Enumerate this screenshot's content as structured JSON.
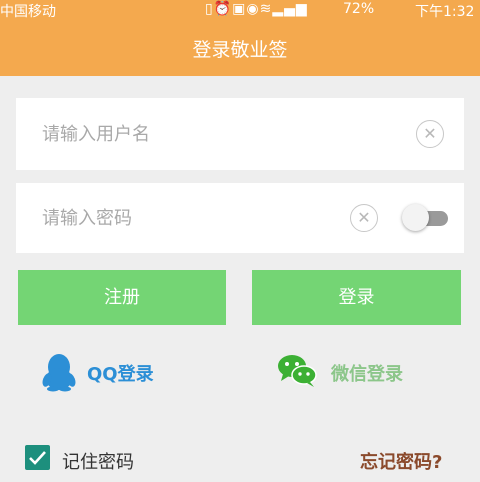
{
  "status_bar": {
    "carrier": "中国移动",
    "icons": [
      "vibrate-icon",
      "alarm-icon",
      "hd-icon",
      "eye-icon",
      "wifi-icon",
      "signal-icon"
    ],
    "battery_text": "72%",
    "time": "下午1:32"
  },
  "header": {
    "title": "登录敬业签"
  },
  "form": {
    "username_placeholder": "请输入用户名",
    "password_placeholder": "请输入密码",
    "clear_glyph": "✕",
    "show_password": false
  },
  "buttons": {
    "register": "注册",
    "login": "登录"
  },
  "social": {
    "qq_label": "QQ登录",
    "wechat_label": "微信登录"
  },
  "options": {
    "remember_label": "记住密码",
    "remember_checked": true,
    "forgot_label": "忘记密码?"
  },
  "colors": {
    "accent": "#f4a94e",
    "button": "#74d574",
    "qq": "#2c8fd6",
    "wechat": "#8cc68a",
    "checkbox": "#1d8f7d",
    "forgot": "#8b4a2c"
  }
}
